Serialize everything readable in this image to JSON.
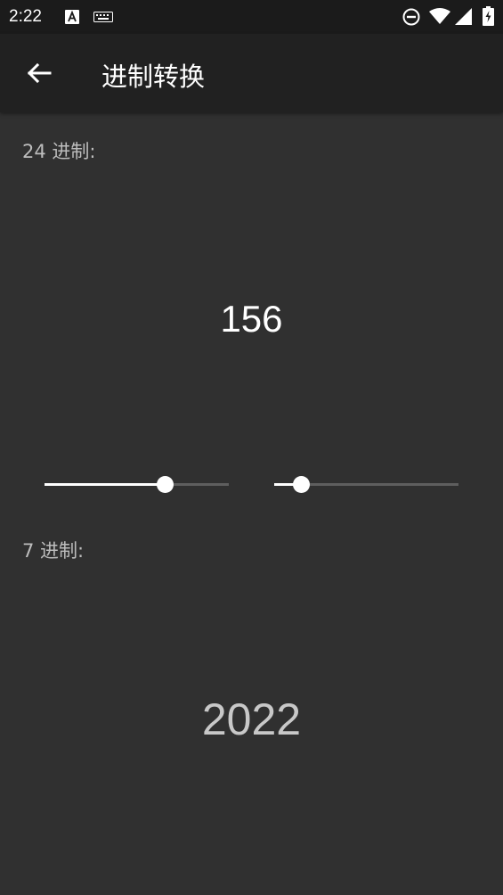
{
  "status_bar": {
    "time": "2:22",
    "icons": [
      "a-text-icon",
      "keyboard-icon",
      "dnd-icon",
      "wifi-icon",
      "signal-icon",
      "battery-charging-icon"
    ]
  },
  "app_bar": {
    "back_icon": "arrow-left-icon",
    "title": "进制转换"
  },
  "source": {
    "label": "24 进制:",
    "value": "156"
  },
  "sliders": {
    "left_level": 0.65,
    "right_level": 0.145
  },
  "target": {
    "label": "7 进制:",
    "value": "2022"
  },
  "colors": {
    "background": "#303030",
    "app_bar": "#212121",
    "status_bar": "#1b1b1b",
    "label_text": "#bdbdbd",
    "value_text": "#ffffff",
    "result_text": "#c8c8c8"
  }
}
